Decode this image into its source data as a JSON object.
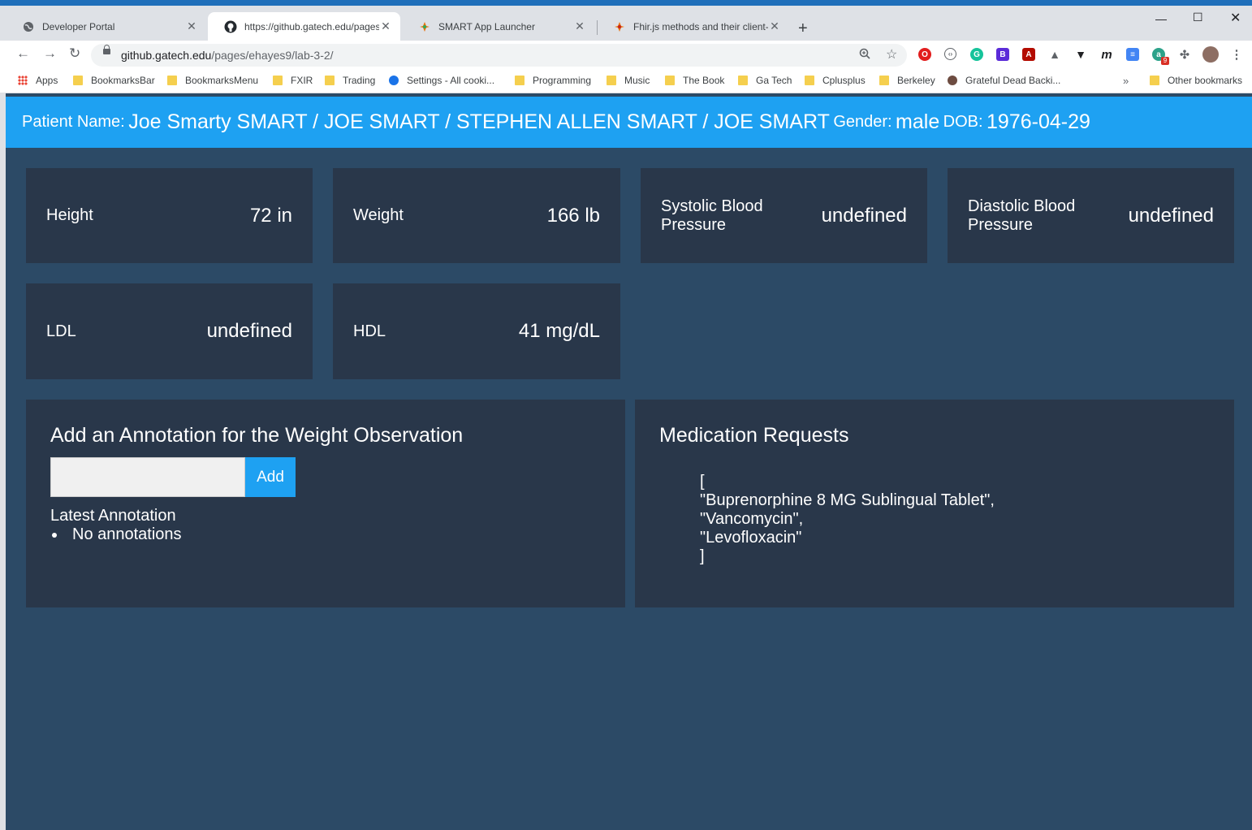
{
  "browser": {
    "tabs": [
      {
        "title": "Developer Portal"
      },
      {
        "title": "https://github.gatech.edu/pages/"
      },
      {
        "title": "SMART App Launcher"
      },
      {
        "title": "Fhir.js methods and their client-js"
      }
    ],
    "url_host": "github.gatech.edu",
    "url_path": "/pages/ehayes9/lab-3-2/",
    "bookmarks": [
      "Apps",
      "BookmarksBar",
      "BookmarksMenu",
      "FXIR",
      "Trading",
      "Settings - All cooki...",
      "Programming",
      "Music",
      "The Book",
      "Ga Tech",
      "Cplusplus",
      "Berkeley",
      "Grateful Dead Backi...",
      "Other bookmarks"
    ],
    "ext_badge": "9"
  },
  "patient": {
    "name_label": "Patient Name:",
    "name": "Joe Smarty SMART / JOE SMART / STEPHEN ALLEN SMART / JOE SMART",
    "gender_label": "Gender:",
    "gender": "male",
    "dob_label": "DOB:",
    "dob": "1976-04-29"
  },
  "observations": [
    {
      "name": "Height",
      "value": "72 in"
    },
    {
      "name": "Weight",
      "value": "166 lb"
    },
    {
      "name": "Systolic Blood Pressure",
      "value": "undefined"
    },
    {
      "name": "Diastolic Blood Pressure",
      "value": "undefined"
    },
    {
      "name": "LDL",
      "value": "undefined"
    },
    {
      "name": "HDL",
      "value": "41 mg/dL"
    }
  ],
  "annotation": {
    "title": "Add an Annotation for the Weight Observation",
    "input_value": "",
    "add_label": "Add",
    "latest_label": "Latest Annotation",
    "items": [
      "No annotations"
    ]
  },
  "medications": {
    "title": "Medication Requests",
    "json_text": "[\n\"Buprenorphine 8 MG Sublingual Tablet\",\n\"Vancomycin\",\n\"Levofloxacin\"\n]"
  }
}
